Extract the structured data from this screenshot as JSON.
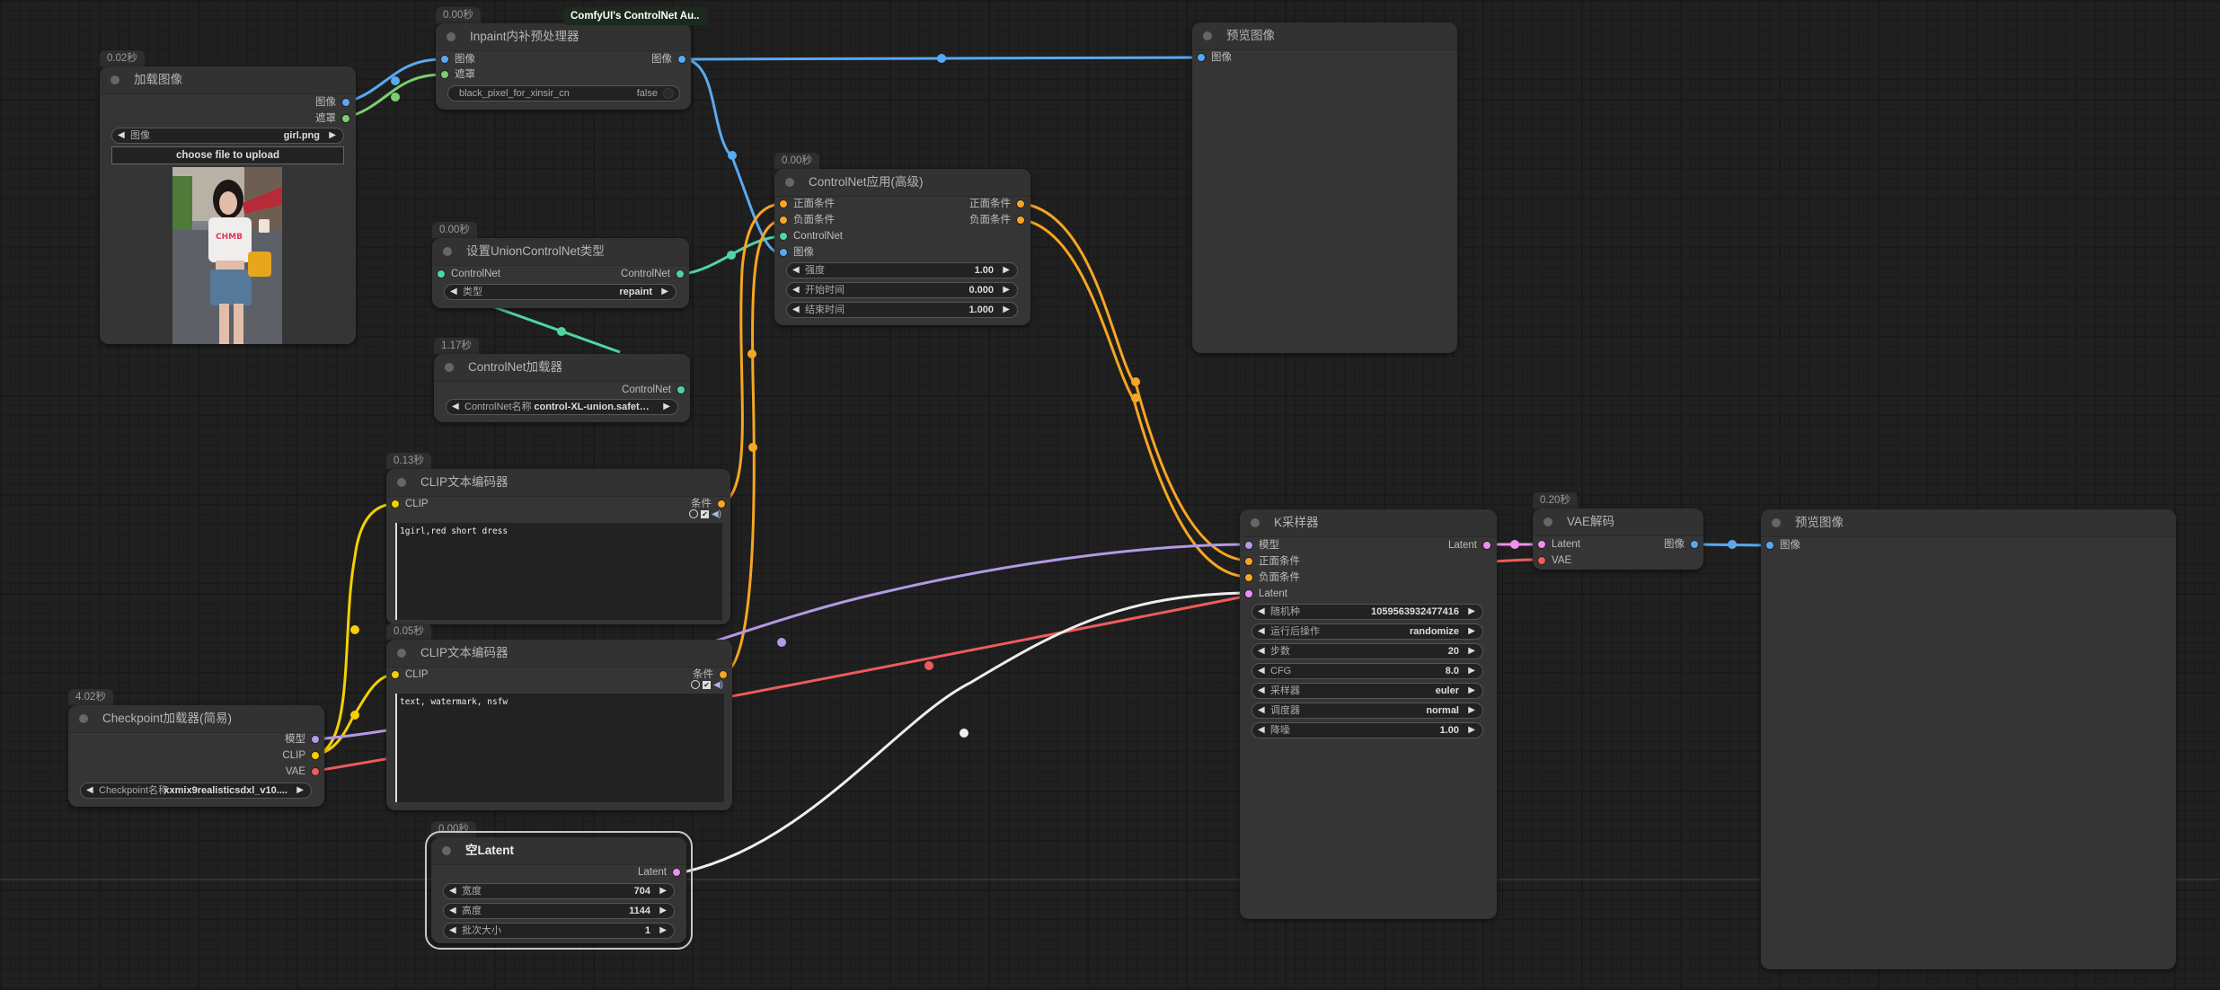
{
  "colors": {
    "image": "#5aa9f0",
    "mask": "#7ccf6f",
    "controlnet": "#4fd6a0",
    "conditioning": "#f6a623",
    "clip": "#f5d000",
    "model": "#b29ae4",
    "vae": "#ef5b5b",
    "latent": "#f08ef0",
    "white_link": "#eeeeee"
  },
  "nodes": {
    "load_image": {
      "time": "0.02秒",
      "title": "加载图像",
      "outputs": [
        "图像",
        "遮罩"
      ],
      "widget": {
        "label": "图像",
        "value": "girl.png"
      },
      "upload_label": "choose file to upload",
      "thumbnail": "girl street photo preview"
    },
    "inpaint_pre": {
      "time": "0.00秒",
      "ext_badge": "ComfyUI's ControlNet Au..",
      "title": "Inpaint内补预处理器",
      "inputs": [
        "图像",
        "遮罩"
      ],
      "outputs": [
        "图像"
      ],
      "toggle": {
        "label": "black_pixel_for_xinsir_cn",
        "value": "false"
      }
    },
    "preview_top": {
      "title": "预览图像",
      "inputs": [
        "图像"
      ]
    },
    "cn_apply": {
      "time": "0.00秒",
      "title": "ControlNet应用(高级)",
      "inputs": [
        "正面条件",
        "负面条件",
        "ControlNet",
        "图像"
      ],
      "outputs": [
        "正面条件",
        "负面条件"
      ],
      "widgets": [
        {
          "label": "强度",
          "value": "1.00"
        },
        {
          "label": "开始时间",
          "value": "0.000"
        },
        {
          "label": "结束时间",
          "value": "1.000"
        }
      ]
    },
    "union_type": {
      "time": "0.00秒",
      "title": "设置UnionControlNet类型",
      "inputs": [
        "ControlNet"
      ],
      "outputs": [
        "ControlNet"
      ],
      "widget": {
        "label": "类型",
        "value": "repaint"
      }
    },
    "cn_loader": {
      "time": "1.17秒",
      "title": "ControlNet加载器",
      "outputs": [
        "ControlNet"
      ],
      "widget": {
        "label": "ControlNet名称",
        "value": "control-XL-union.safeten..."
      }
    },
    "clip_pos": {
      "time": "0.13秒",
      "title": "CLIP文本编码器",
      "inputs": [
        "CLIP"
      ],
      "outputs": [
        "条件"
      ],
      "text": "1girl,red short dress"
    },
    "clip_neg": {
      "time": "0.05秒",
      "title": "CLIP文本编码器",
      "inputs": [
        "CLIP"
      ],
      "outputs": [
        "条件"
      ],
      "text": "text, watermark, nsfw"
    },
    "checkpoint": {
      "time": "4.02秒",
      "title": "Checkpoint加载器(简易)",
      "outputs": [
        "模型",
        "CLIP",
        "VAE"
      ],
      "widget": {
        "label": "Checkpoint名称",
        "value": "xxmix9realisticsdxl_v10...."
      }
    },
    "empty_latent": {
      "time": "0.00秒",
      "title": "空Latent",
      "outputs": [
        "Latent"
      ],
      "widgets": [
        {
          "label": "宽度",
          "value": "704"
        },
        {
          "label": "高度",
          "value": "1144"
        },
        {
          "label": "批次大小",
          "value": "1"
        }
      ]
    },
    "ksampler": {
      "title": "K采样器",
      "inputs": [
        "模型",
        "正面条件",
        "负面条件",
        "Latent"
      ],
      "outputs": [
        "Latent"
      ],
      "widgets": [
        {
          "label": "随机种",
          "value": "1059563932477416"
        },
        {
          "label": "运行后操作",
          "value": "randomize"
        },
        {
          "label": "步数",
          "value": "20"
        },
        {
          "label": "CFG",
          "value": "8.0"
        },
        {
          "label": "采样器",
          "value": "euler"
        },
        {
          "label": "调度器",
          "value": "normal"
        },
        {
          "label": "降噪",
          "value": "1.00"
        }
      ]
    },
    "vae_decode": {
      "time": "0.20秒",
      "title": "VAE解码",
      "inputs": [
        "Latent",
        "VAE"
      ],
      "outputs": [
        "图像"
      ]
    },
    "preview_bottom": {
      "title": "预览图像",
      "inputs": [
        "图像"
      ]
    }
  },
  "glyphs": {
    "arrow_left": "◀",
    "arrow_right": "▶",
    "check": "✔",
    "speaker": "🔊"
  }
}
